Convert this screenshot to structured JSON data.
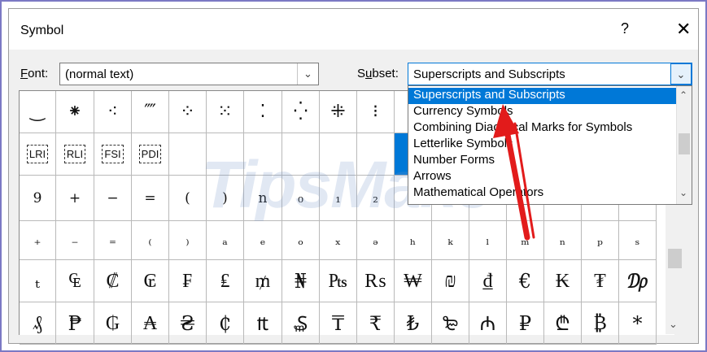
{
  "dialog": {
    "title": "Symbol",
    "help": "?",
    "close": "✕"
  },
  "font": {
    "label_key": "F",
    "label_rest": "ont:",
    "value": "(normal text)"
  },
  "subset": {
    "label_pre": "S",
    "label_key": "u",
    "label_rest": "bset:",
    "value": "Superscripts and Subscripts"
  },
  "dropdown": {
    "items": [
      "Superscripts and Subscripts",
      "Currency Symbols",
      "Combining Diacritical Marks for Symbols",
      "Letterlike Symbols",
      "Number Forms",
      "Arrows",
      "Mathematical Operators"
    ],
    "selected_index": 0
  },
  "watermark": "TipsMake",
  "grid": {
    "rows": [
      [
        "‿",
        "⁕",
        "⁖",
        "⁗",
        "⁘",
        "⁙",
        "⁚",
        "⁛",
        "⁜",
        "⁝",
        "",
        "",
        "",
        "",
        "",
        "",
        ""
      ],
      [
        "LRI",
        "RLI",
        "FSI",
        "PDI",
        "",
        "",
        "",
        "",
        "",
        "",
        "",
        "",
        "",
        "",
        "",
        "",
        ""
      ],
      [
        "9",
        "+",
        "−",
        "=",
        "(",
        ")",
        "n",
        "₀",
        "₁",
        "₂",
        "",
        "",
        "",
        "",
        "",
        "",
        ""
      ],
      [
        "₊",
        "₋",
        "₌",
        "₍",
        "₎",
        "ₐ",
        "ₑ",
        "ₒ",
        "ₓ",
        "ₔ",
        "ₕ",
        "ₖ",
        "ₗ",
        "ₘ",
        "ₙ",
        "ₚ",
        "ₛ"
      ],
      [
        "ₜ",
        "₠",
        "₡",
        "₢",
        "₣",
        "₤",
        "₥",
        "₦",
        "₧",
        "₨",
        "₩",
        "₪",
        "₫",
        "€",
        "₭",
        "₮",
        "₯"
      ],
      [
        "₰",
        "₱",
        "₲",
        "₳",
        "₴",
        "₵",
        "₶",
        "₷",
        "₸",
        "₹",
        "₺",
        "₻",
        "₼",
        "₽",
        "₾",
        "₿",
        "*"
      ]
    ]
  }
}
